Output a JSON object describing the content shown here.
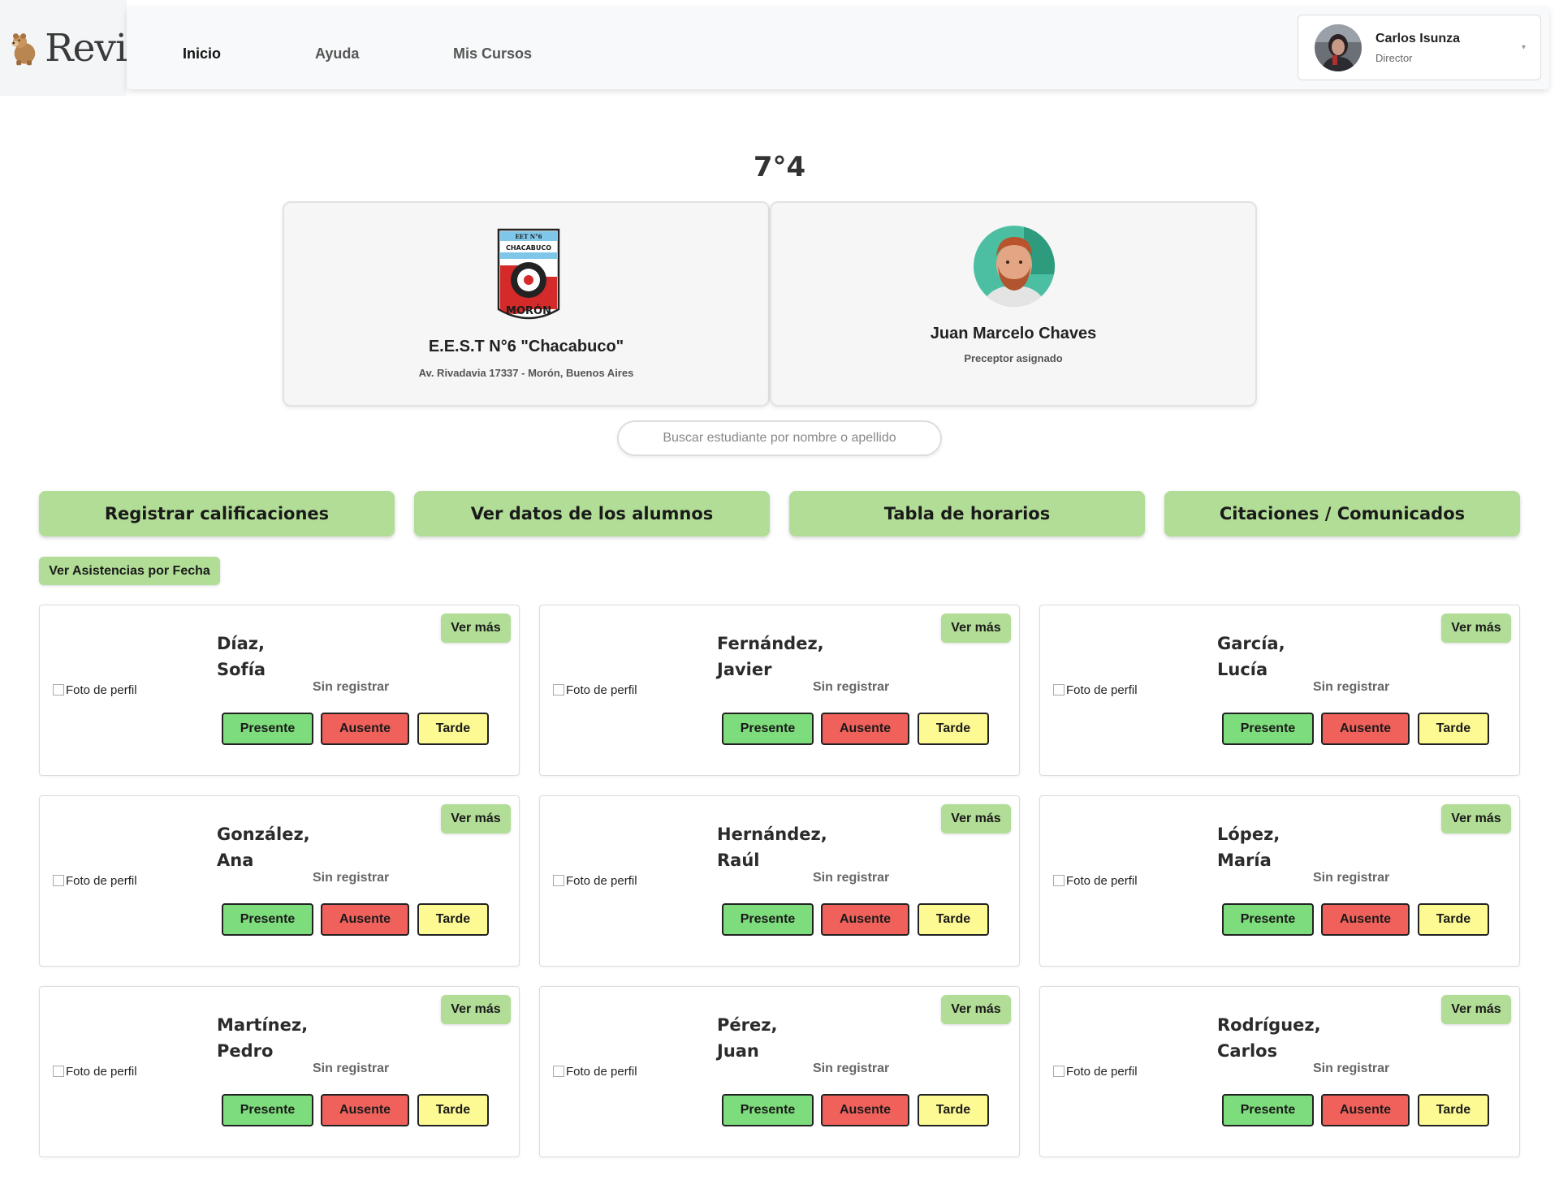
{
  "app": {
    "logo_text": "Revi"
  },
  "nav": {
    "items": [
      {
        "label": "Inicio",
        "active": true
      },
      {
        "label": "Ayuda",
        "active": false
      },
      {
        "label": "Mis Cursos",
        "active": false
      }
    ]
  },
  "user": {
    "name": "Carlos Isunza",
    "role": "Director"
  },
  "course": {
    "title": "7°4"
  },
  "school": {
    "logo_text_top": "EET N°6",
    "logo_text_mid": "CHACABUCO",
    "logo_text_bottom": "MORÓN",
    "name": "E.E.S.T N°6 \"Chacabuco\"",
    "address": "Av. Rivadavia 17337 - Morón, Buenos Aires"
  },
  "preceptor": {
    "name": "Juan Marcelo Chaves",
    "role": "Preceptor asignado"
  },
  "search": {
    "placeholder": "Buscar estudiante por nombre o apellido"
  },
  "actions": [
    {
      "label": "Registrar calificaciones"
    },
    {
      "label": "Ver datos de los alumnos"
    },
    {
      "label": "Tabla de horarios"
    },
    {
      "label": "Citaciones / Comunicados"
    }
  ],
  "attendance_by_date_label": "Ver Asistencias por Fecha",
  "student_card_labels": {
    "photo_alt": "Foto de perfil",
    "ver_mas": "Ver más",
    "presente": "Presente",
    "ausente": "Ausente",
    "tarde": "Tarde"
  },
  "students": [
    {
      "last_name": "Díaz,",
      "first_name": "Sofía",
      "status": "Sin registrar"
    },
    {
      "last_name": "Fernández,",
      "first_name": "Javier",
      "status": "Sin registrar"
    },
    {
      "last_name": "García,",
      "first_name": "Lucía",
      "status": "Sin registrar"
    },
    {
      "last_name": "González,",
      "first_name": "Ana",
      "status": "Sin registrar"
    },
    {
      "last_name": "Hernández,",
      "first_name": "Raúl",
      "status": "Sin registrar"
    },
    {
      "last_name": "López,",
      "first_name": "María",
      "status": "Sin registrar"
    },
    {
      "last_name": "Martínez,",
      "first_name": "Pedro",
      "status": "Sin registrar"
    },
    {
      "last_name": "Pérez,",
      "first_name": "Juan",
      "status": "Sin registrar"
    },
    {
      "last_name": "Rodríguez,",
      "first_name": "Carlos",
      "status": "Sin registrar"
    }
  ],
  "colors": {
    "accent_green": "#b1dd96",
    "presente": "#7ddc7b",
    "ausente": "#f0615b",
    "tarde": "#fdfa94"
  },
  "icons": {
    "logo": "bear-logo-icon",
    "user_menu": "chevron-down-icon"
  }
}
